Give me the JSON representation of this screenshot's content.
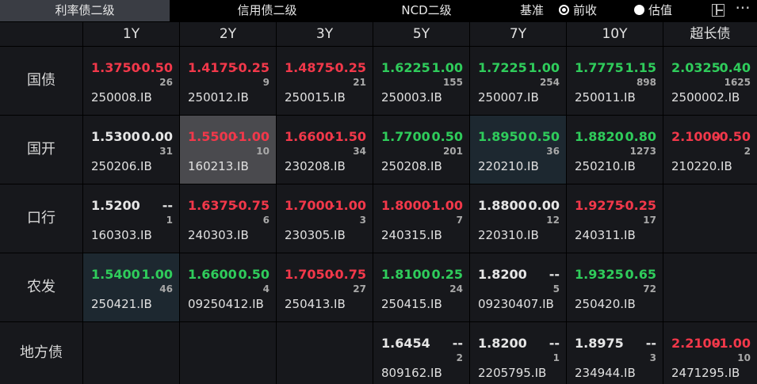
{
  "tabs": [
    "利率债二级",
    "信用债二级",
    "NCD二级"
  ],
  "active_tab": 0,
  "basis_label": "基准",
  "radios": [
    {
      "label": "前收",
      "selected": true
    },
    {
      "label": "估值",
      "selected": false
    }
  ],
  "icons": {
    "layout": "layout-icon",
    "more": "more-icon"
  },
  "more_glyph": "···",
  "colors": {
    "up": "#f2384a",
    "down": "#2fcc5b",
    "flat": "#e6e6e6",
    "cell_bg": "#17181c",
    "selected_bg": "#4a4a4e",
    "highlight_bg": "#1d2830"
  },
  "columns": [
    "1Y",
    "2Y",
    "3Y",
    "5Y",
    "7Y",
    "10Y",
    "超长债"
  ],
  "rows": [
    {
      "label": "国债",
      "cells": [
        {
          "yield": "1.3750",
          "change": "-0.50",
          "count": "26",
          "code": "250008.IB",
          "color": "red",
          "state": ""
        },
        {
          "yield": "1.4175",
          "change": "-0.25",
          "count": "9",
          "code": "250012.IB",
          "color": "red",
          "state": ""
        },
        {
          "yield": "1.4875",
          "change": "-0.25",
          "count": "21",
          "code": "250015.IB",
          "color": "red",
          "state": ""
        },
        {
          "yield": "1.6225",
          "change": "1.00",
          "count": "155",
          "code": "250003.IB",
          "color": "green",
          "state": ""
        },
        {
          "yield": "1.7225",
          "change": "1.00",
          "count": "254",
          "code": "250007.IB",
          "color": "green",
          "state": ""
        },
        {
          "yield": "1.7775",
          "change": "1.15",
          "count": "898",
          "code": "250011.IB",
          "color": "green",
          "state": ""
        },
        {
          "yield": "2.0325",
          "change": "0.40",
          "count": "1625",
          "code": "2500002.IB",
          "color": "green",
          "state": ""
        }
      ]
    },
    {
      "label": "国开",
      "cells": [
        {
          "yield": "1.5300",
          "change": "0.00",
          "count": "31",
          "code": "250206.IB",
          "color": "white",
          "state": ""
        },
        {
          "yield": "1.5500",
          "change": "-1.00",
          "count": "10",
          "code": "160213.IB",
          "color": "red",
          "state": "sel"
        },
        {
          "yield": "1.6600",
          "change": "-1.50",
          "count": "34",
          "code": "230208.IB",
          "color": "red",
          "state": ""
        },
        {
          "yield": "1.7700",
          "change": "0.50",
          "count": "201",
          "code": "250208.IB",
          "color": "green",
          "state": ""
        },
        {
          "yield": "1.8950",
          "change": "0.50",
          "count": "36",
          "code": "220210.IB",
          "color": "green",
          "state": "hl"
        },
        {
          "yield": "1.8820",
          "change": "0.80",
          "count": "1273",
          "code": "250210.IB",
          "color": "green",
          "state": ""
        },
        {
          "yield": "2.1000",
          "change": "-0.50",
          "count": "2",
          "code": "210220.IB",
          "color": "red",
          "state": ""
        }
      ]
    },
    {
      "label": "口行",
      "cells": [
        {
          "yield": "1.5200",
          "change": "--",
          "count": "1",
          "code": "160303.IB",
          "color": "white",
          "state": ""
        },
        {
          "yield": "1.6375",
          "change": "-0.75",
          "count": "6",
          "code": "240303.IB",
          "color": "red",
          "state": ""
        },
        {
          "yield": "1.7000",
          "change": "-1.00",
          "count": "3",
          "code": "230305.IB",
          "color": "red",
          "state": ""
        },
        {
          "yield": "1.8000",
          "change": "-1.00",
          "count": "7",
          "code": "240315.IB",
          "color": "red",
          "state": ""
        },
        {
          "yield": "1.8800",
          "change": "0.00",
          "count": "12",
          "code": "220310.IB",
          "color": "white",
          "state": ""
        },
        {
          "yield": "1.9275",
          "change": "-0.25",
          "count": "17",
          "code": "240311.IB",
          "color": "red",
          "state": ""
        },
        null
      ]
    },
    {
      "label": "农发",
      "cells": [
        {
          "yield": "1.5400",
          "change": "1.00",
          "count": "46",
          "code": "250421.IB",
          "color": "green",
          "state": "hl"
        },
        {
          "yield": "1.6600",
          "change": "0.50",
          "count": "4",
          "code": "09250412.IB",
          "color": "green",
          "state": ""
        },
        {
          "yield": "1.7050",
          "change": "-0.75",
          "count": "27",
          "code": "250413.IB",
          "color": "red",
          "state": ""
        },
        {
          "yield": "1.8100",
          "change": "0.25",
          "count": "24",
          "code": "250415.IB",
          "color": "green",
          "state": ""
        },
        {
          "yield": "1.8200",
          "change": "--",
          "count": "5",
          "code": "09230407.IB",
          "color": "white",
          "state": ""
        },
        {
          "yield": "1.9325",
          "change": "0.65",
          "count": "72",
          "code": "250420.IB",
          "color": "green",
          "state": ""
        },
        null
      ]
    },
    {
      "label": "地方债",
      "cells": [
        null,
        null,
        null,
        {
          "yield": "1.6454",
          "change": "--",
          "count": "2",
          "code": "809162.IB",
          "color": "white",
          "state": ""
        },
        {
          "yield": "1.8200",
          "change": "--",
          "count": "1",
          "code": "2205795.IB",
          "color": "white",
          "state": ""
        },
        {
          "yield": "1.8975",
          "change": "--",
          "count": "3",
          "code": "234944.IB",
          "color": "white",
          "state": ""
        },
        {
          "yield": "2.2100",
          "change": "-1.00",
          "count": "10",
          "code": "2471295.IB",
          "color": "red",
          "state": ""
        }
      ]
    }
  ]
}
